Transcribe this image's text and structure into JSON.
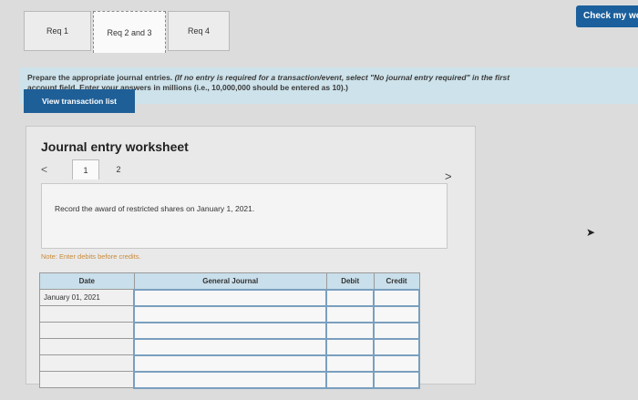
{
  "header": {
    "check_button": "Check my wor"
  },
  "tabs": [
    {
      "label": "Req 1"
    },
    {
      "label": "Req 2 and 3"
    },
    {
      "label": "Req 4"
    }
  ],
  "instructions": {
    "line1_bold": "Prepare the appropriate journal entries.",
    "line1_italic": "(If no entry is required for a transaction/event, select \"No journal entry required\" in the first",
    "line2": "account field. Enter your answers in millions (i.e., 10,000,000 should be entered as 10).)"
  },
  "view_button": "View transaction list",
  "worksheet": {
    "title": "Journal entry worksheet",
    "prev": "<",
    "next": ">",
    "pages": [
      "1",
      "2"
    ],
    "record_text": "Record the award of restricted shares on January 1, 2021.",
    "note": "Note: Enter debits before credits.",
    "columns": {
      "date": "Date",
      "general_journal": "General Journal",
      "debit": "Debit",
      "credit": "Credit"
    },
    "rows": [
      {
        "date": "January 01, 2021"
      },
      {
        "date": ""
      },
      {
        "date": ""
      },
      {
        "date": ""
      },
      {
        "date": ""
      },
      {
        "date": ""
      }
    ]
  }
}
